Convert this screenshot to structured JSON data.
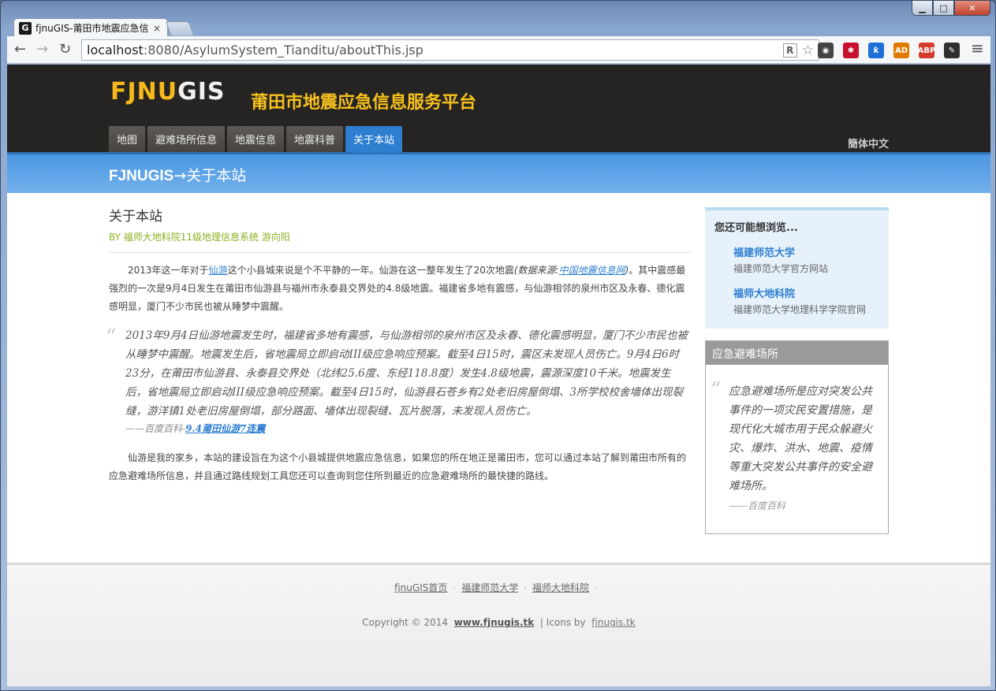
{
  "browser": {
    "tab_title": "fjnuGIS-莆田市地震应急信",
    "tab_favicon": "G",
    "tab_close": "×",
    "url_host": "localhost",
    "url_rest": ":8080/AsylumSystem_Tianditu/aboutThis.jsp",
    "omni_r": "R",
    "star": "☆",
    "back": "←",
    "forward": "→",
    "reload": "↻",
    "win_min": "▁",
    "win_max": "□",
    "win_close": "✕",
    "menu": "≡",
    "extensions": [
      {
        "name": "chrome-web-store-icon",
        "label": "◉",
        "color": "#444444"
      },
      {
        "name": "red-extension-icon",
        "label": "✱",
        "color": "#c8102e"
      },
      {
        "name": "blue-extension-icon",
        "label": "ƙ",
        "color": "#1d6fd6"
      },
      {
        "name": "issuu-icon",
        "label": "AD",
        "color": "#e07b00"
      },
      {
        "name": "adblock-plus-icon",
        "label": "ABP",
        "color": "#d43b2a"
      },
      {
        "name": "evernote-icon",
        "label": "✎",
        "color": "#2f2f2f"
      }
    ]
  },
  "header": {
    "logo_a": "FJNU",
    "logo_b": "GIS",
    "title": "莆田市地震应急信息服务平台",
    "nav": [
      "地图",
      "避难场所信息",
      "地震信息",
      "地震科普",
      "关于本站"
    ],
    "lang": "簡体中文"
  },
  "banner": {
    "brand": "FJNUGIS",
    "arrow": "→",
    "page": "关于本站"
  },
  "article": {
    "title": "关于本站",
    "byline": "BY 福师大地科院11级地理信息系统 游向阳",
    "p1_a": "2013年这一年对于",
    "p1_link": "仙游",
    "p1_b": "这个小县城来说是个不平静的一年。仙游在这一整年发生了20次地震",
    "p1_src_a": "(数据来源:",
    "p1_src_link": "中国地震信息网",
    "p1_src_b": ")",
    "p1_c": "。其中震感最强烈的一次是9月4日发生在莆田市仙游县与福州市永泰县交界处的4.8级地震。福建省多地有震感，与仙游相邻的泉州市区及永春、德化震感明显，厦门不少市民也被从睡梦中震醒。",
    "quote": "2013年9月4日仙游地震发生时，福建省多地有震感，与仙游相邻的泉州市区及永春、德化震感明显，厦门不少市民也被从睡梦中震醒。地震发生后，省地震局立即启动III级应急响应预案。截至4日15时，震区未发现人员伤亡。9月4日6时23分，在莆田市仙游县、永泰县交界处（北纬25.6度、东经118.8度）发生4.8级地震，震源深度10千米。地震发生后，省地震局立即启动III级应急响应预案。截至4日15时，仙游县石苍乡有2处老旧房屋倒塌、3所学校校舍墙体出现裂缝，游洋镇1处老旧房屋倒塌，部分路面、墙体出现裂缝、瓦片脱落，未发现人员伤亡。",
    "quote_src_a": "——百度百科-",
    "quote_src_link": "9.4莆田仙游7连震",
    "p2": "仙游是我的家乡，本站的建设旨在为这个小县城提供地震应急信息，如果您的所在地正是莆田市，您可以通过本站了解到莆田市所有的应急避难场所信息，并且通过路线规划工具您还可以查询到您住所到最近的应急避难场所的最快捷的路线。"
  },
  "sidebar": {
    "heading": "您还可能想浏览...",
    "links": [
      {
        "label": "福建师范大学",
        "desc": "福建师范大学官方网站"
      },
      {
        "label": "福师大地科院",
        "desc": "福建师范大学地理科学学院官网"
      }
    ],
    "box_title": "应急避难场所",
    "quote": "应急避难场所是应对突发公共事件的一项灾民安置措施，是现代化大城市用于民众躲避火灾、爆炸、洪水、地震、疫情等重大突发公共事件的安全避难场所。",
    "quote_src": "——百度百科",
    "quote_mark": "“"
  },
  "footer": {
    "links": [
      "fjnuGIS首页",
      "福建师范大学",
      "福师大地科院"
    ],
    "sep": "·",
    "copy_a": "Copyright © 2014",
    "copy_site": "www.fjnugis.tk",
    "copy_b": "| Icons by",
    "copy_icons": "fjnugis.tk"
  }
}
